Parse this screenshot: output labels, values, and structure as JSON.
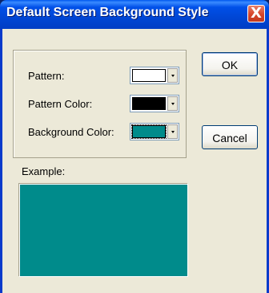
{
  "window": {
    "title": "Default Screen Background Style",
    "close_label": "X"
  },
  "form": {
    "pattern_label": "Pattern:",
    "pattern_color_label": "Pattern Color:",
    "background_color_label": "Background Color:",
    "pattern_swatch_color": "#ffffff",
    "pattern_color_swatch_color": "#000000",
    "background_color_swatch_color": "#008b8b",
    "example_label": "Example:",
    "example_color": "#008b8b"
  },
  "buttons": {
    "ok_label": "OK",
    "cancel_label": "Cancel"
  },
  "icons": {
    "close": "close-icon",
    "dropdown": "chevron-down-icon"
  }
}
